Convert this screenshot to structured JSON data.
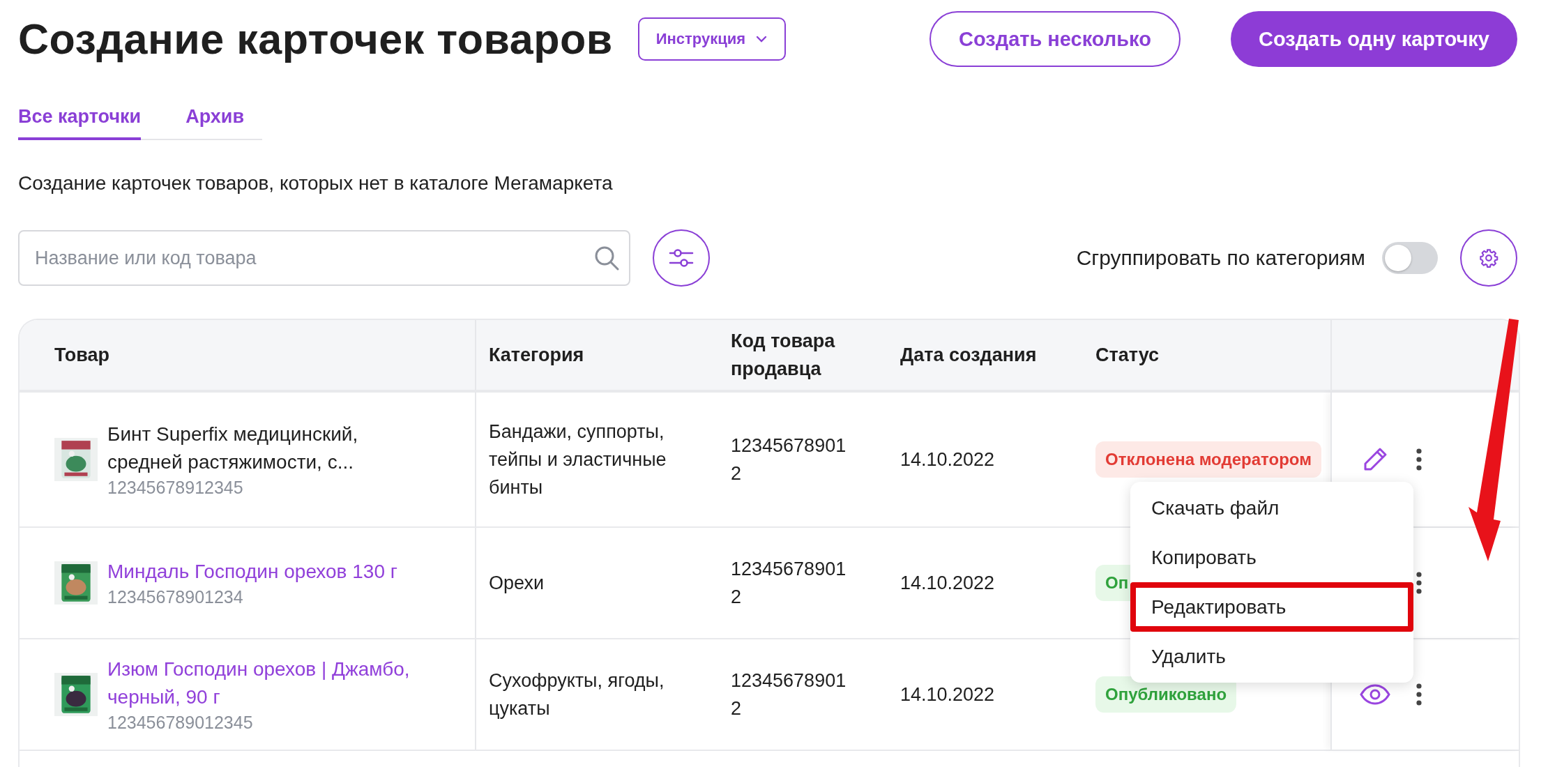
{
  "header": {
    "title": "Создание карточек товаров",
    "instruction_dropdown": "Инструкция",
    "buttons": [
      {
        "label": "Создать несколько",
        "kind": "outline"
      },
      {
        "label": "Создать одну карточку",
        "kind": "primary"
      }
    ]
  },
  "tabs": [
    {
      "label": "Все карточки",
      "selected": true
    },
    {
      "label": "Архив",
      "selected": false
    }
  ],
  "subtitle": "Создание карточек товаров, которых нет в каталоге Мегамаркета",
  "search": {
    "placeholder": "Название или код товара"
  },
  "group_toggle": {
    "label": "Сгруппировать по категориям",
    "on": false
  },
  "table": {
    "columns": [
      "Товар",
      "Категория",
      "Код товара продавца",
      "Дата создания",
      "Статус"
    ],
    "rows": [
      {
        "name": "Бинт Superfix медицинский, средней растяжимости, с...",
        "linked": false,
        "code": "12345678912345",
        "category": "Бандажи, суппорты, тейпы и эластичные бинты",
        "seller_code": "123456789012",
        "date": "14.10.2022",
        "status": {
          "label": "Отклонена модератором",
          "kind": "rejected"
        },
        "action": {
          "kind": "edit"
        }
      },
      {
        "name": "Миндаль Господин орехов 130 г",
        "linked": true,
        "code": "12345678901234",
        "category": "Орехи",
        "seller_code": "123456789012",
        "date": "14.10.2022",
        "status": {
          "label": "Оп",
          "kind": "published"
        },
        "action": {
          "kind": "none"
        }
      },
      {
        "name": "Изюм Господин орехов | Джамбо, черный, 90 г",
        "linked": true,
        "code": "123456789012345",
        "category": "Сухофрукты, ягоды, цукаты",
        "seller_code": "123456789012",
        "date": "14.10.2022",
        "status": {
          "label": "Опубликовано",
          "kind": "published"
        },
        "action": {
          "kind": "view"
        }
      }
    ]
  },
  "context_menu": {
    "items": [
      {
        "label": "Скачать файл",
        "highlighted": false
      },
      {
        "label": "Копировать",
        "highlighted": false
      },
      {
        "label": "Редактировать",
        "highlighted": true
      },
      {
        "label": "Удалить",
        "highlighted": false
      }
    ]
  }
}
